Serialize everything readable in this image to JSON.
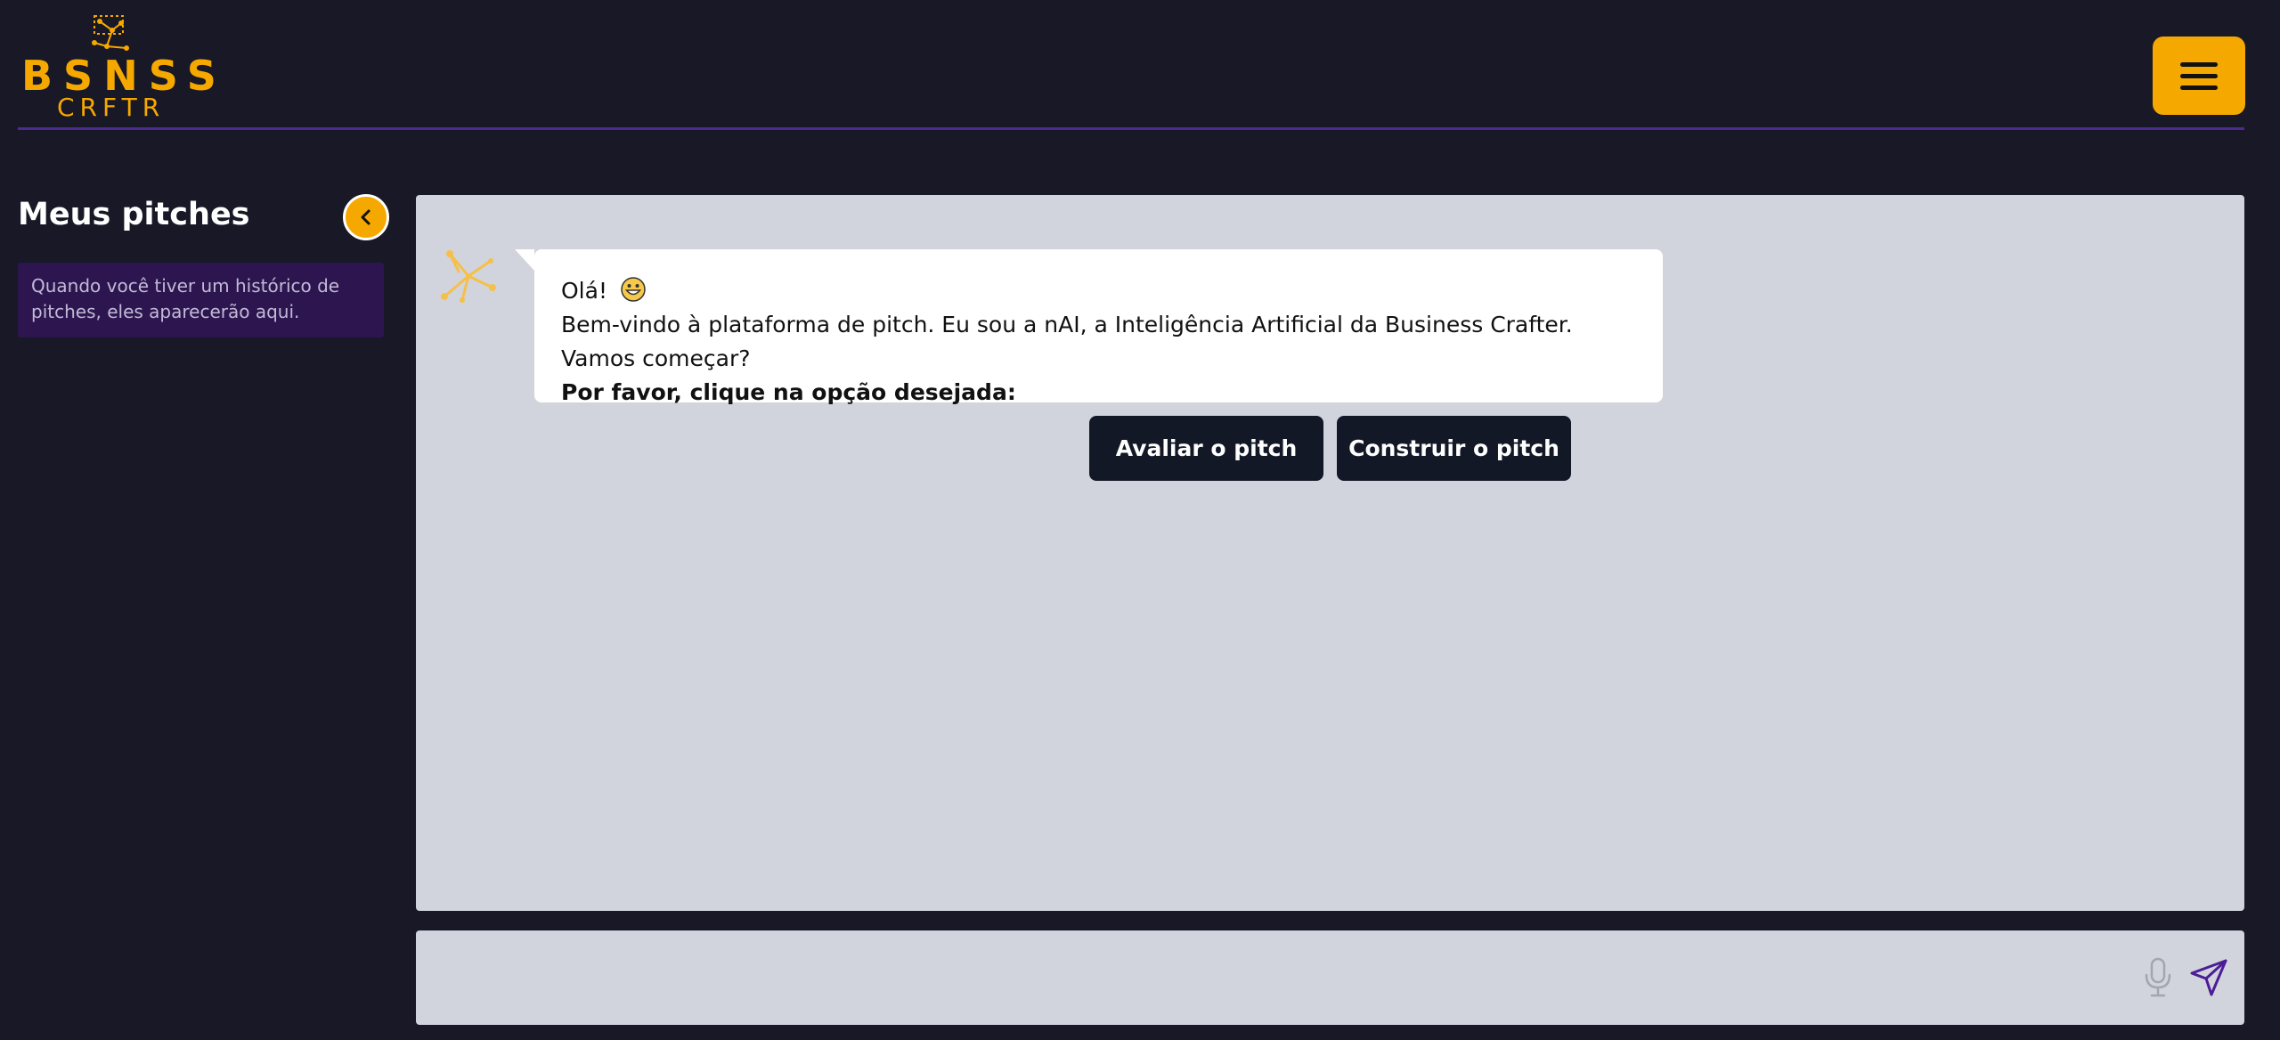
{
  "brand": {
    "name_top": "BSNSS",
    "name_bottom": "CRFTR",
    "accent_color": "#f5a800",
    "divider_color": "#4c2a8f"
  },
  "header": {
    "menu_icon": "hamburger-menu-icon"
  },
  "sidebar": {
    "title": "Meus pitches",
    "collapse_icon": "chevron-left-icon",
    "empty_message": "Quando você tiver um histórico de pitches, eles aparecerão aqui."
  },
  "chat": {
    "bot_avatar_icon": "network-nodes-icon",
    "messages": [
      {
        "greeting": "Olá!",
        "greeting_emoji": "grinning-face-icon",
        "body": "Bem-vindo à plataforma de pitch. Eu sou a nAI, a Inteligência Artificial da Business Crafter. Vamos começar?",
        "prompt": "Por favor, clique na opção desejada:"
      }
    ],
    "options": [
      {
        "label": "Avaliar o pitch"
      },
      {
        "label": "Construir o pitch"
      }
    ]
  },
  "composer": {
    "placeholder": "",
    "mic_icon": "microphone-icon",
    "send_icon": "send-icon"
  }
}
